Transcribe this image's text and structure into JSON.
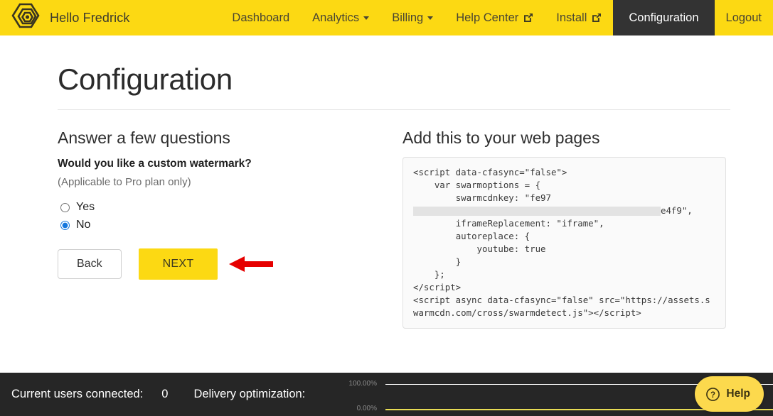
{
  "navbar": {
    "logo_icon": "hexagon-nested-logo",
    "greeting": "Hello Fredrick",
    "links": [
      {
        "label": "Dashboard",
        "icon": "",
        "dropdown": false,
        "active": false
      },
      {
        "label": "Analytics",
        "icon": "chevron-down-icon",
        "dropdown": true,
        "active": false
      },
      {
        "label": "Billing",
        "icon": "chevron-down-icon",
        "dropdown": true,
        "active": false
      },
      {
        "label": "Help Center",
        "icon": "external-link-icon",
        "dropdown": false,
        "active": false
      },
      {
        "label": "Install",
        "icon": "external-link-icon",
        "dropdown": false,
        "active": false
      },
      {
        "label": "Configuration",
        "icon": "",
        "dropdown": false,
        "active": true
      },
      {
        "label": "Logout",
        "icon": "",
        "dropdown": false,
        "active": false
      }
    ],
    "bg_color": "#fcd913",
    "active_bg_color": "#333333"
  },
  "page": {
    "title": "Configuration"
  },
  "form": {
    "section_heading": "Answer a few questions",
    "question": "Would you like a custom watermark?",
    "note": "(Applicable to Pro plan only)",
    "options": [
      {
        "label": "Yes",
        "value": "yes",
        "selected": false
      },
      {
        "label": "No",
        "value": "no",
        "selected": true
      }
    ],
    "back_label": "Back",
    "next_label": "NEXT",
    "arrow_icon": "left-arrow-annotation",
    "arrow_color": "#e60000"
  },
  "code_panel": {
    "heading": "Add this to your web pages",
    "line1": "<script data-cfasync=\"false\">",
    "line2": "    var swarmoptions = {",
    "line3_prefix": "        swarmcdnkey: \"fe97",
    "line3_redacted": "redacted-key-segment",
    "line3_suffix": "e4f9\",",
    "line4": "        iframeReplacement: \"iframe\",",
    "line5": "        autoreplace: {",
    "line6": "            youtube: true",
    "line7": "        }",
    "line8": "    };",
    "line9": "</script>",
    "line10": "<script async data-cfasync=\"false\" src=\"https://assets.swarmcdn.com/cross/swarmdetect.js\"></script>"
  },
  "bottom_bar": {
    "users_label": "Current users connected:",
    "users_value": "0",
    "delivery_label": "Delivery optimization:",
    "bg_color": "#262626"
  },
  "chart_data": {
    "type": "line",
    "title": "Delivery optimization",
    "xlabel": "",
    "ylabel": "",
    "ylim": [
      0,
      100
    ],
    "grid": true,
    "tick_labels": [
      "100.00%",
      "0.00%"
    ],
    "legend_position": "none",
    "series": [
      {
        "name": "baseline-100",
        "color": "#ffffff",
        "values": [
          100,
          100
        ]
      },
      {
        "name": "delivery-optimization",
        "color": "#e8dc54",
        "values": [
          0,
          0
        ]
      }
    ],
    "x": [
      0,
      1
    ]
  },
  "help_widget": {
    "label": "Help",
    "icon": "question-mark-circle-icon",
    "bg_color": "#fcd94d"
  }
}
